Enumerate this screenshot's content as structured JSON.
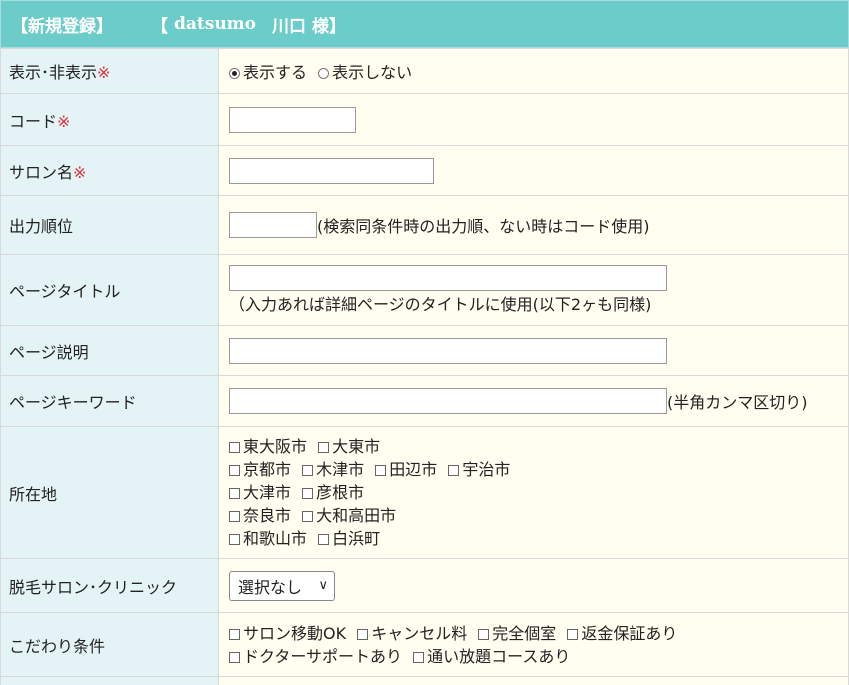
{
  "header": {
    "title": "【新規登録】",
    "user_bracket_open": "【",
    "user_name": "datsumo",
    "salon_name": "川口 様",
    "user_bracket_close": "】"
  },
  "required_mark": "※",
  "rows": {
    "display": {
      "label": "表示･非表示",
      "options": [
        {
          "label": "表示する",
          "selected": true
        },
        {
          "label": "表示しない",
          "selected": false
        }
      ]
    },
    "code": {
      "label": "コード",
      "value": ""
    },
    "salon_name": {
      "label": "サロン名",
      "value": ""
    },
    "order": {
      "label": "出力順位",
      "value": "",
      "note": "(検索同条件時の出力順、ない時はコード使用)"
    },
    "page_title": {
      "label": "ページタイトル",
      "value": "",
      "note": "（入力あれば詳細ページのタイトルに使用(以下2ヶも同様)"
    },
    "page_desc": {
      "label": "ページ説明",
      "value": ""
    },
    "page_keywords": {
      "label": "ページキーワード",
      "value": "",
      "note": "(半角カンマ区切り)"
    },
    "location": {
      "label": "所在地",
      "lines": [
        [
          "東大阪市",
          "大東市"
        ],
        [
          "京都市",
          "木津市",
          "田辺市",
          "宇治市"
        ],
        [
          "大津市",
          "彦根市"
        ],
        [
          "奈良市",
          "大和高田市"
        ],
        [
          "和歌山市",
          "白浜町"
        ]
      ]
    },
    "clinic_type": {
      "label": "脱毛サロン･クリニック",
      "selected": "選択なし"
    },
    "kodawari": {
      "label": "こだわり条件",
      "lines": [
        [
          "サロン移動OK",
          "キャンセル料",
          "完全個室",
          "返金保証あり"
        ],
        [
          "ドクターサポートあり",
          "通い放題コースあり"
        ]
      ]
    }
  },
  "colors": {
    "header_bg": "#6cccca",
    "label_bg": "#e4f3f5",
    "field_bg": "#fffef0",
    "required": "#e0323a"
  }
}
